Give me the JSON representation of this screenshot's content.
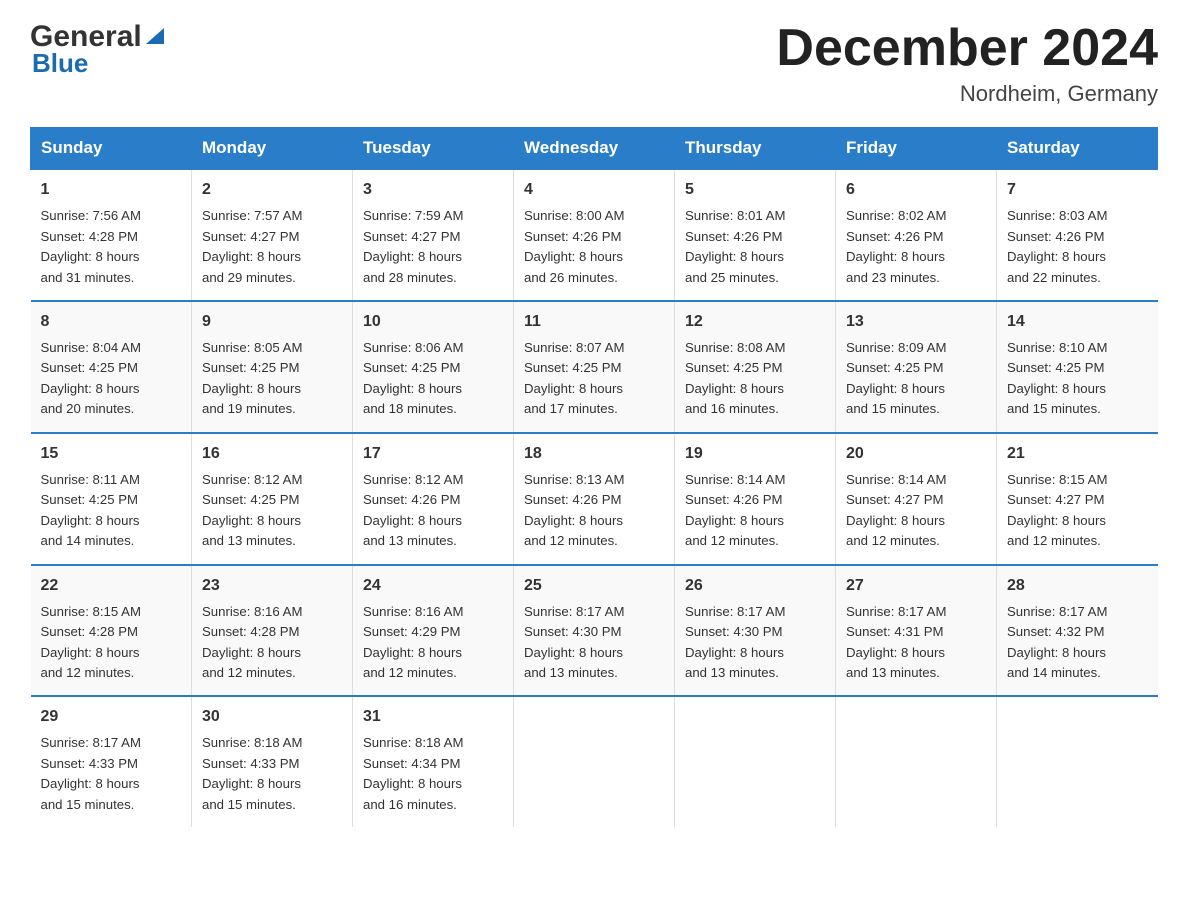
{
  "header": {
    "logo_general": "General",
    "logo_blue": "Blue",
    "month_title": "December 2024",
    "location": "Nordheim, Germany"
  },
  "days_of_week": [
    "Sunday",
    "Monday",
    "Tuesday",
    "Wednesday",
    "Thursday",
    "Friday",
    "Saturday"
  ],
  "weeks": [
    [
      {
        "num": "1",
        "info": "Sunrise: 7:56 AM\nSunset: 4:28 PM\nDaylight: 8 hours\nand 31 minutes."
      },
      {
        "num": "2",
        "info": "Sunrise: 7:57 AM\nSunset: 4:27 PM\nDaylight: 8 hours\nand 29 minutes."
      },
      {
        "num": "3",
        "info": "Sunrise: 7:59 AM\nSunset: 4:27 PM\nDaylight: 8 hours\nand 28 minutes."
      },
      {
        "num": "4",
        "info": "Sunrise: 8:00 AM\nSunset: 4:26 PM\nDaylight: 8 hours\nand 26 minutes."
      },
      {
        "num": "5",
        "info": "Sunrise: 8:01 AM\nSunset: 4:26 PM\nDaylight: 8 hours\nand 25 minutes."
      },
      {
        "num": "6",
        "info": "Sunrise: 8:02 AM\nSunset: 4:26 PM\nDaylight: 8 hours\nand 23 minutes."
      },
      {
        "num": "7",
        "info": "Sunrise: 8:03 AM\nSunset: 4:26 PM\nDaylight: 8 hours\nand 22 minutes."
      }
    ],
    [
      {
        "num": "8",
        "info": "Sunrise: 8:04 AM\nSunset: 4:25 PM\nDaylight: 8 hours\nand 20 minutes."
      },
      {
        "num": "9",
        "info": "Sunrise: 8:05 AM\nSunset: 4:25 PM\nDaylight: 8 hours\nand 19 minutes."
      },
      {
        "num": "10",
        "info": "Sunrise: 8:06 AM\nSunset: 4:25 PM\nDaylight: 8 hours\nand 18 minutes."
      },
      {
        "num": "11",
        "info": "Sunrise: 8:07 AM\nSunset: 4:25 PM\nDaylight: 8 hours\nand 17 minutes."
      },
      {
        "num": "12",
        "info": "Sunrise: 8:08 AM\nSunset: 4:25 PM\nDaylight: 8 hours\nand 16 minutes."
      },
      {
        "num": "13",
        "info": "Sunrise: 8:09 AM\nSunset: 4:25 PM\nDaylight: 8 hours\nand 15 minutes."
      },
      {
        "num": "14",
        "info": "Sunrise: 8:10 AM\nSunset: 4:25 PM\nDaylight: 8 hours\nand 15 minutes."
      }
    ],
    [
      {
        "num": "15",
        "info": "Sunrise: 8:11 AM\nSunset: 4:25 PM\nDaylight: 8 hours\nand 14 minutes."
      },
      {
        "num": "16",
        "info": "Sunrise: 8:12 AM\nSunset: 4:25 PM\nDaylight: 8 hours\nand 13 minutes."
      },
      {
        "num": "17",
        "info": "Sunrise: 8:12 AM\nSunset: 4:26 PM\nDaylight: 8 hours\nand 13 minutes."
      },
      {
        "num": "18",
        "info": "Sunrise: 8:13 AM\nSunset: 4:26 PM\nDaylight: 8 hours\nand 12 minutes."
      },
      {
        "num": "19",
        "info": "Sunrise: 8:14 AM\nSunset: 4:26 PM\nDaylight: 8 hours\nand 12 minutes."
      },
      {
        "num": "20",
        "info": "Sunrise: 8:14 AM\nSunset: 4:27 PM\nDaylight: 8 hours\nand 12 minutes."
      },
      {
        "num": "21",
        "info": "Sunrise: 8:15 AM\nSunset: 4:27 PM\nDaylight: 8 hours\nand 12 minutes."
      }
    ],
    [
      {
        "num": "22",
        "info": "Sunrise: 8:15 AM\nSunset: 4:28 PM\nDaylight: 8 hours\nand 12 minutes."
      },
      {
        "num": "23",
        "info": "Sunrise: 8:16 AM\nSunset: 4:28 PM\nDaylight: 8 hours\nand 12 minutes."
      },
      {
        "num": "24",
        "info": "Sunrise: 8:16 AM\nSunset: 4:29 PM\nDaylight: 8 hours\nand 12 minutes."
      },
      {
        "num": "25",
        "info": "Sunrise: 8:17 AM\nSunset: 4:30 PM\nDaylight: 8 hours\nand 13 minutes."
      },
      {
        "num": "26",
        "info": "Sunrise: 8:17 AM\nSunset: 4:30 PM\nDaylight: 8 hours\nand 13 minutes."
      },
      {
        "num": "27",
        "info": "Sunrise: 8:17 AM\nSunset: 4:31 PM\nDaylight: 8 hours\nand 13 minutes."
      },
      {
        "num": "28",
        "info": "Sunrise: 8:17 AM\nSunset: 4:32 PM\nDaylight: 8 hours\nand 14 minutes."
      }
    ],
    [
      {
        "num": "29",
        "info": "Sunrise: 8:17 AM\nSunset: 4:33 PM\nDaylight: 8 hours\nand 15 minutes."
      },
      {
        "num": "30",
        "info": "Sunrise: 8:18 AM\nSunset: 4:33 PM\nDaylight: 8 hours\nand 15 minutes."
      },
      {
        "num": "31",
        "info": "Sunrise: 8:18 AM\nSunset: 4:34 PM\nDaylight: 8 hours\nand 16 minutes."
      },
      {
        "num": "",
        "info": ""
      },
      {
        "num": "",
        "info": ""
      },
      {
        "num": "",
        "info": ""
      },
      {
        "num": "",
        "info": ""
      }
    ]
  ]
}
